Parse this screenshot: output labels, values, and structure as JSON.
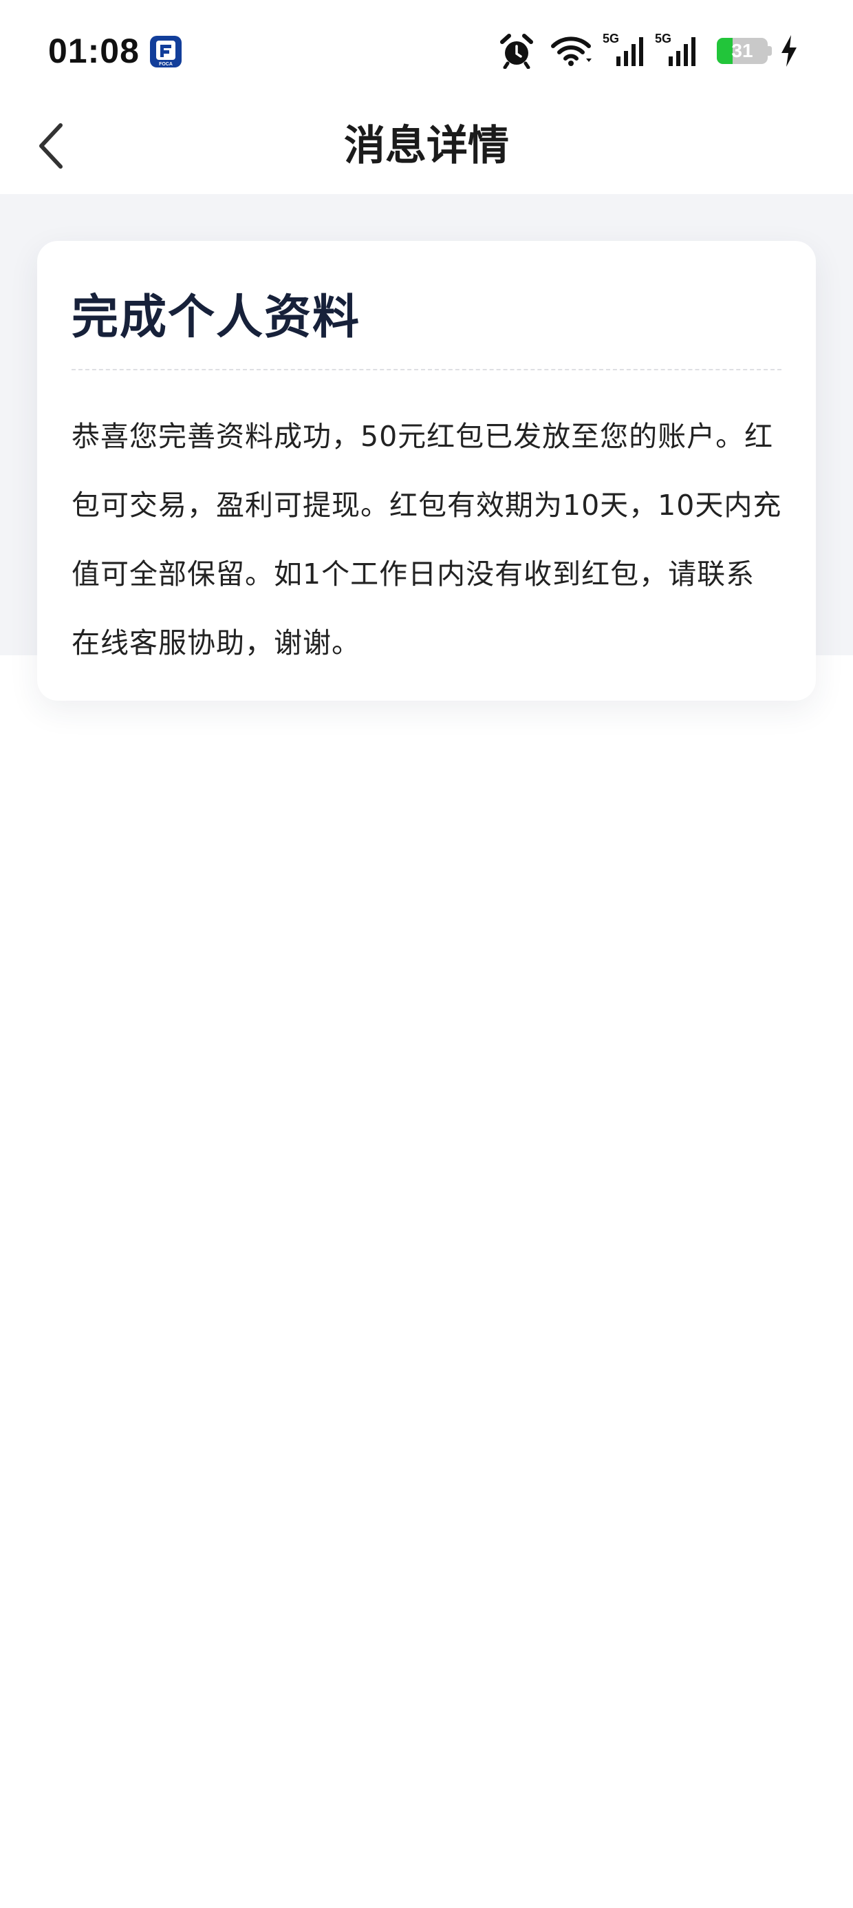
{
  "status_bar": {
    "time": "01:08",
    "app_badge": "FOCA",
    "icons": [
      "alarm-icon",
      "wifi-icon",
      "signal-5g-icon",
      "signal-5g-icon",
      "battery-icon",
      "charging-bolt-icon"
    ],
    "network_1": "5G",
    "network_2": "5G",
    "battery_level": "31",
    "battery_fraction": 0.31,
    "battery_color": "#22c53a"
  },
  "nav": {
    "back_icon": "chevron-left-icon",
    "title": "消息详情"
  },
  "message": {
    "title": "完成个人资料",
    "body": "恭喜您完善资料成功，50元红包已发放至您的账户。红包可交易，盈利可提现。红包有效期为10天，10天内充值可全部保留。如1个工作日内没有收到红包，请联系在线客服协助，谢谢。"
  },
  "colors": {
    "title_text": "#17213a",
    "band_background": "#f3f4f7",
    "card_background": "#ffffff"
  }
}
